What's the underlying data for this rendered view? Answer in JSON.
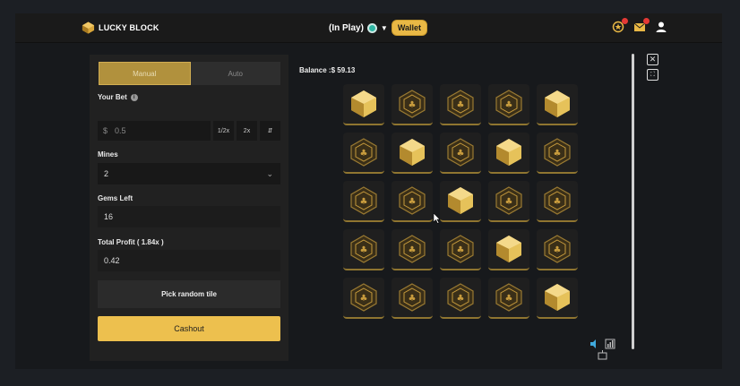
{
  "header": {
    "logo_text": "LUCKY BLOCK",
    "status": "(In Play)",
    "wallet_label": "Wallet"
  },
  "game": {
    "tabs": [
      {
        "label": "Manual",
        "active": true
      },
      {
        "label": "Auto",
        "active": false
      }
    ],
    "your_bet_label": "Your Bet",
    "bet_currency": "$",
    "bet_value": "0.5",
    "half_label": "1/2x",
    "double_label": "2x",
    "mines_label": "Mines",
    "mines_value": "2",
    "gems_left_label": "Gems Left",
    "gems_left_value": "16",
    "profit_label": "Total Profit ( 1.84x )",
    "profit_value": "0.42",
    "random_label": "Pick random tile",
    "cashout_label": "Cashout"
  },
  "board": {
    "balance": "Balance :$ 59.13",
    "tiles": [
      "gem",
      "hidden",
      "hidden",
      "hidden",
      "gem",
      "hidden",
      "gem",
      "hidden",
      "gem",
      "hidden",
      "hidden",
      "hidden",
      "gem",
      "hidden",
      "hidden",
      "hidden",
      "hidden",
      "hidden",
      "gem",
      "hidden",
      "hidden",
      "hidden",
      "hidden",
      "hidden",
      "gem"
    ]
  },
  "colors": {
    "accent": "#edc04e",
    "tab_active": "#b1913d",
    "gem": "#e6c25a"
  }
}
